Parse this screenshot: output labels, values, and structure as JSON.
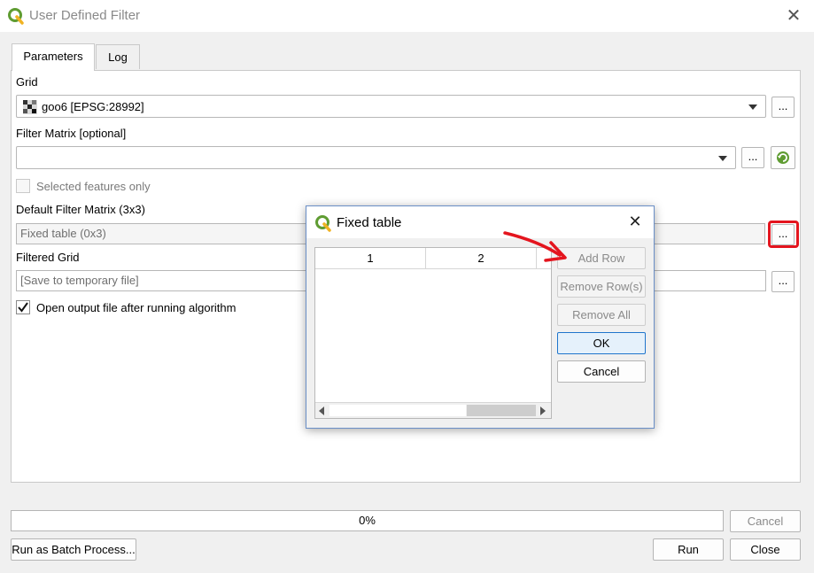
{
  "window": {
    "title": "User Defined Filter",
    "close_glyph": "✕"
  },
  "tabs": [
    {
      "label": "Parameters"
    },
    {
      "label": "Log"
    }
  ],
  "params": {
    "grid_label": "Grid",
    "grid_value": "goo6 [EPSG:28992]",
    "filter_matrix_label": "Filter Matrix [optional]",
    "filter_matrix_value": "",
    "selected_only_label": "Selected features only",
    "default_filter_label": "Default Filter Matrix (3x3)",
    "default_filter_value": "Fixed table (0x3)",
    "filtered_grid_label": "Filtered Grid",
    "filtered_grid_placeholder": "[Save to temporary file]",
    "open_output_label": "Open output file after running algorithm",
    "open_output_checked": true,
    "dots_label": "..."
  },
  "dialog": {
    "title": "Fixed table",
    "columns": [
      "1",
      "2"
    ],
    "buttons": {
      "add_row": "Add Row",
      "remove_rows": "Remove Row(s)",
      "remove_all": "Remove All",
      "ok": "OK",
      "cancel": "Cancel"
    }
  },
  "footer": {
    "progress_text": "0%",
    "progress_value": 0,
    "cancel": "Cancel",
    "batch": "Run as Batch Process...",
    "run": "Run",
    "close": "Close"
  },
  "colors": {
    "annotation_red": "#e4151e",
    "qgis_green": "#5f9c32",
    "accent_blue": "#1f75cc"
  }
}
